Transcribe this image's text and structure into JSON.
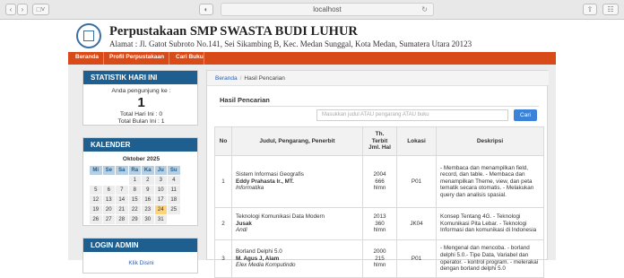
{
  "browser": {
    "url": "localhost"
  },
  "header": {
    "title": "Perpustakaan SMP SWASTA BUDI LUHUR",
    "address": "Alamat : Jl. Gatot Subroto No.141, Sei Sikambing B, Kec. Medan Sunggal, Kota Medan, Sumatera Utara 20123"
  },
  "nav": {
    "items": [
      "Beranda",
      "Profil Perpustakaan",
      "Cari Buku"
    ]
  },
  "stats": {
    "heading": "STATISTIK HARI INI",
    "visitor_label": "Anda pengunjung ke :",
    "visitor_number": "1",
    "today_total": "Total Hari Ini : 0",
    "month_total": "Total Bulan Ini : 1"
  },
  "calendar": {
    "heading": "KALENDER",
    "month": "Oktober 2025",
    "days": [
      "Mi",
      "Se",
      "Sa",
      "Ra",
      "Ka",
      "Ju",
      "Su"
    ],
    "weeks": [
      [
        "",
        "",
        "",
        "1",
        "2",
        "3",
        "4"
      ],
      [
        "5",
        "6",
        "7",
        "8",
        "9",
        "10",
        "11"
      ],
      [
        "12",
        "13",
        "14",
        "15",
        "16",
        "17",
        "18"
      ],
      [
        "19",
        "20",
        "21",
        "22",
        "23",
        "24",
        "25"
      ],
      [
        "26",
        "27",
        "28",
        "29",
        "30",
        "31",
        ""
      ]
    ],
    "today": "24"
  },
  "login": {
    "heading": "LOGIN ADMIN",
    "link": "Klik Disini"
  },
  "breadcrumb": {
    "home": "Beranda",
    "current": "Hasil Pencarian"
  },
  "results": {
    "title": "Hasil Pencarian",
    "search_placeholder": "Masukkan judul ATAU pengarang ATAU buku",
    "search_button": "Cari",
    "columns": [
      "No",
      "Judul, Pengarang, Penerbit",
      "Th. Terbit Jml. Hal",
      "Lokasi",
      "Deskripsi"
    ],
    "rows": [
      {
        "no": "1",
        "title": "Sistem Informasi Geografis",
        "author": "Eddy Prahasta Ir., MT.",
        "publisher": "Informatika",
        "year": "2004",
        "pages": "666",
        "unit": "hlmn",
        "location": "P01",
        "description": "- Membaca dan menampilkan field, record, dan table. - Membaca dan menampilkan Theme, view, dan peta tematik secara otomatis. - Melakukan query dan analisis spasial."
      },
      {
        "no": "2",
        "title": "Teknologi Komunikasi Data Modern",
        "author": "Jusak",
        "publisher": "Andi",
        "year": "2013",
        "pages": "360",
        "unit": "hlmn",
        "location": "JK04",
        "description": "Konsep Tentang 4G. - Teknologi Komunikasi Pita Lebar. - Teknologi Informasi dan komunikasi di Indonesia"
      },
      {
        "no": "3",
        "title": "Borland Delphi 5.0",
        "author": "M. Agus J, Alam",
        "publisher": "Elex Media Komputindo",
        "year": "2000",
        "pages": "215",
        "unit": "hlmn",
        "location": "P01",
        "description": "- Mengenal dan mencoba. - borland delphi 5.0.- Tipe Data, Variabel dan operator. - kontrol program. - melerakai dengan borland delphi 5.0"
      }
    ]
  }
}
